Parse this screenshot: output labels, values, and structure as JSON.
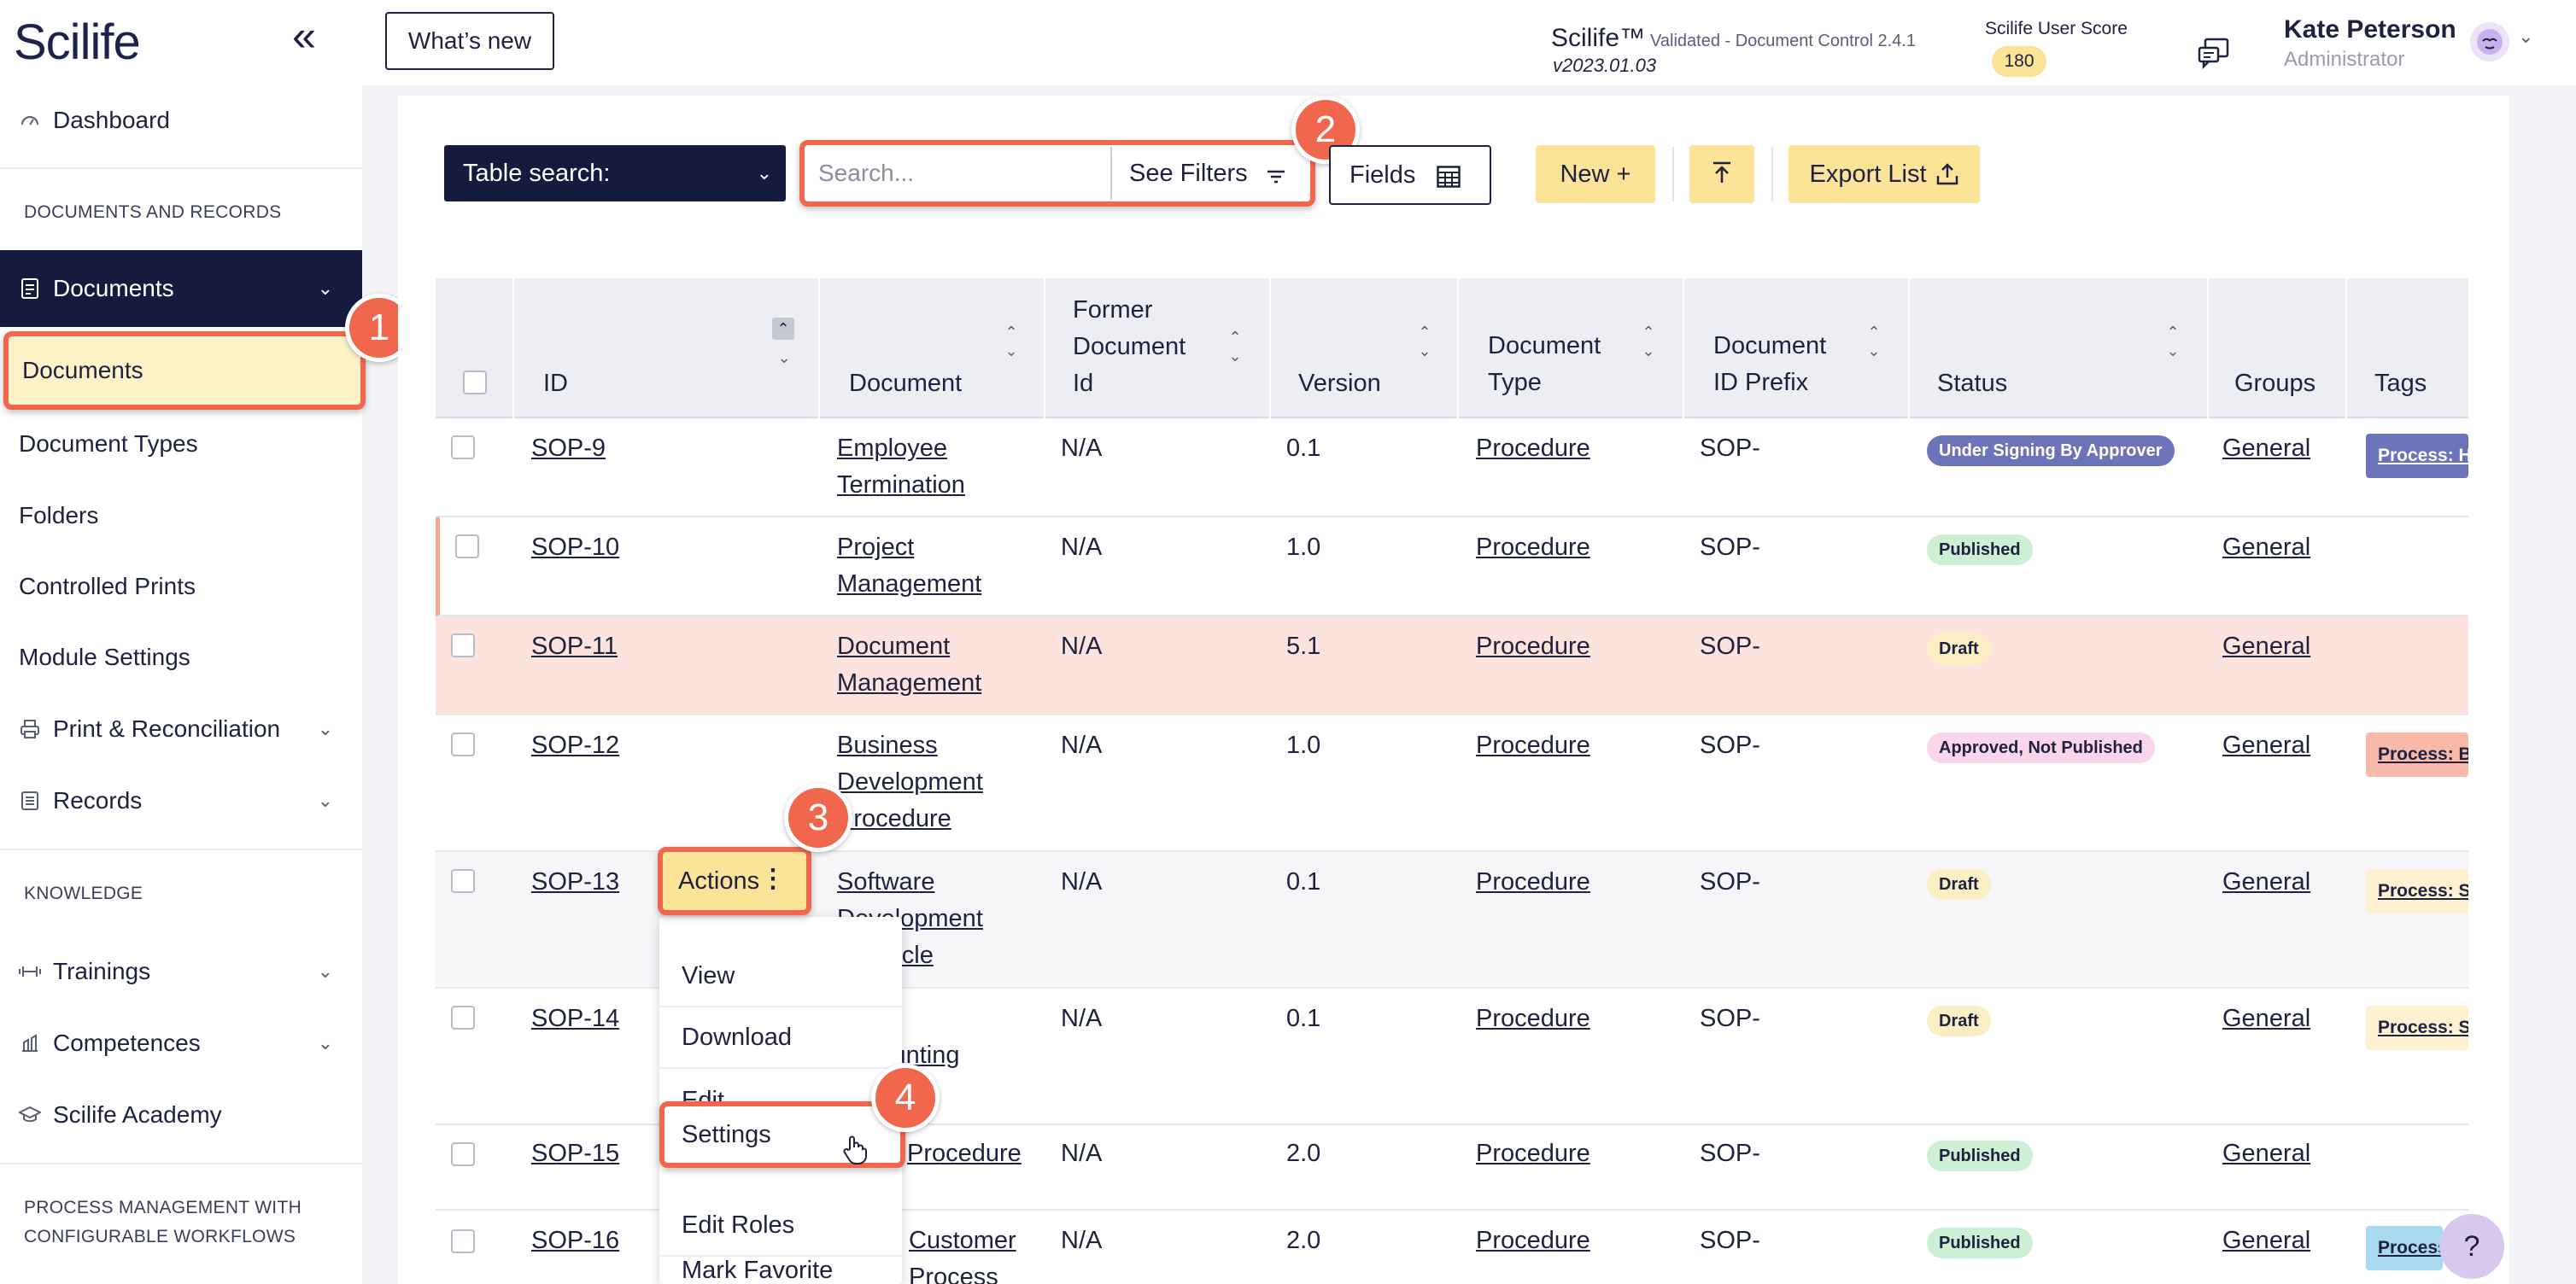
{
  "sidebar": {
    "logo": "Scilife",
    "dashboard": "Dashboard",
    "section_docs": "DOCUMENTS AND RECORDS",
    "documents_parent": "Documents",
    "items": [
      "Documents",
      "Document Types",
      "Folders",
      "Controlled Prints",
      "Module Settings"
    ],
    "print_reconciliation": "Print & Reconciliation",
    "records": "Records",
    "section_knowledge": "KNOWLEDGE",
    "trainings": "Trainings",
    "competences": "Competences",
    "academy": "Scilife Academy",
    "section_process_1": "PROCESS MANAGEMENT WITH",
    "section_process_2": "CONFIGURABLE WORKFLOWS"
  },
  "header": {
    "whats_new": "What’s new",
    "app_name": "Scilife™",
    "app_meta": "Validated - Document Control 2.4.1",
    "app_version": "v2023.01.03",
    "score_label": "Scilife User Score",
    "score_value": "180",
    "user_name": "Kate Peterson",
    "user_role": "Administrator"
  },
  "toolbar": {
    "table_search": "Table search:",
    "search_placeholder": "Search...",
    "see_filters": "See Filters",
    "fields": "Fields",
    "new": "New +",
    "export": "Export List"
  },
  "table": {
    "headers": {
      "id": "ID",
      "document": "Document",
      "former_1": "Former",
      "former_2": "Document",
      "former_3": "Id",
      "version": "Version",
      "type_1": "Document",
      "type_2": "Type",
      "prefix_1": "Document",
      "prefix_2": "ID Prefix",
      "status": "Status",
      "groups": "Groups",
      "tags": "Tags"
    },
    "rows": [
      {
        "id": "SOP-9",
        "doc1": "Employee",
        "doc2": "Termination",
        "doc3": "",
        "former": "N/A",
        "version": "0.1",
        "type": "Procedure",
        "prefix": "SOP-",
        "status": "Under Signing By Approver",
        "group": "General",
        "tag": "Process: H"
      },
      {
        "id": "SOP-10",
        "doc1": "Project",
        "doc2": "Management",
        "doc3": "",
        "former": "N/A",
        "version": "1.0",
        "type": "Procedure",
        "prefix": "SOP-",
        "status": "Published",
        "group": "General",
        "tag": ""
      },
      {
        "id": "SOP-11",
        "doc1": "Document",
        "doc2": "Management",
        "doc3": "",
        "former": "N/A",
        "version": "5.1",
        "type": "Procedure",
        "prefix": "SOP-",
        "status": "Draft",
        "group": "General",
        "tag": ""
      },
      {
        "id": "SOP-12",
        "doc1": "Business",
        "doc2": "Development",
        "doc3": "Procedure",
        "former": "N/A",
        "version": "1.0",
        "type": "Procedure",
        "prefix": "SOP-",
        "status": "Approved, Not Published",
        "group": "General",
        "tag": "Process: B"
      },
      {
        "id": "SOP-13",
        "doc1": "Software",
        "doc2": "Development",
        "doc3": "Lifecycle",
        "former": "N/A",
        "version": "0.1",
        "type": "Procedure",
        "prefix": "SOP-",
        "status": "Draft",
        "group": "General",
        "tag": "Process: S"
      },
      {
        "id": "SOP-14",
        "doc1": "",
        "doc2": "Accounting",
        "doc3": "",
        "former": "N/A",
        "version": "0.1",
        "type": "Procedure",
        "prefix": "SOP-",
        "status": "Draft",
        "group": "General",
        "tag": "Process: S"
      },
      {
        "id": "SOP-15",
        "doc1": "Procedure",
        "doc2": "",
        "doc3": "",
        "former": "N/A",
        "version": "2.0",
        "type": "Procedure",
        "prefix": "SOP-",
        "status": "Published",
        "group": "General",
        "tag": ""
      },
      {
        "id": "SOP-16",
        "doc1": "Customer",
        "doc2": "Process",
        "doc3": "",
        "former": "N/A",
        "version": "2.0",
        "type": "Procedure",
        "prefix": "SOP-",
        "status": "Published",
        "group": "General",
        "tag": "Process"
      }
    ]
  },
  "actions": {
    "label": "Actions",
    "menu": [
      "View",
      "Download",
      "Edit",
      "Settings",
      "Edit Roles",
      "Mark Favorite"
    ]
  },
  "steps": [
    "1",
    "2",
    "3",
    "4"
  ],
  "colors": {
    "navy": "#151b3f",
    "highlight": "#f0674e",
    "yellow": "#fbe398",
    "row_highlight": "#fde3dd"
  }
}
